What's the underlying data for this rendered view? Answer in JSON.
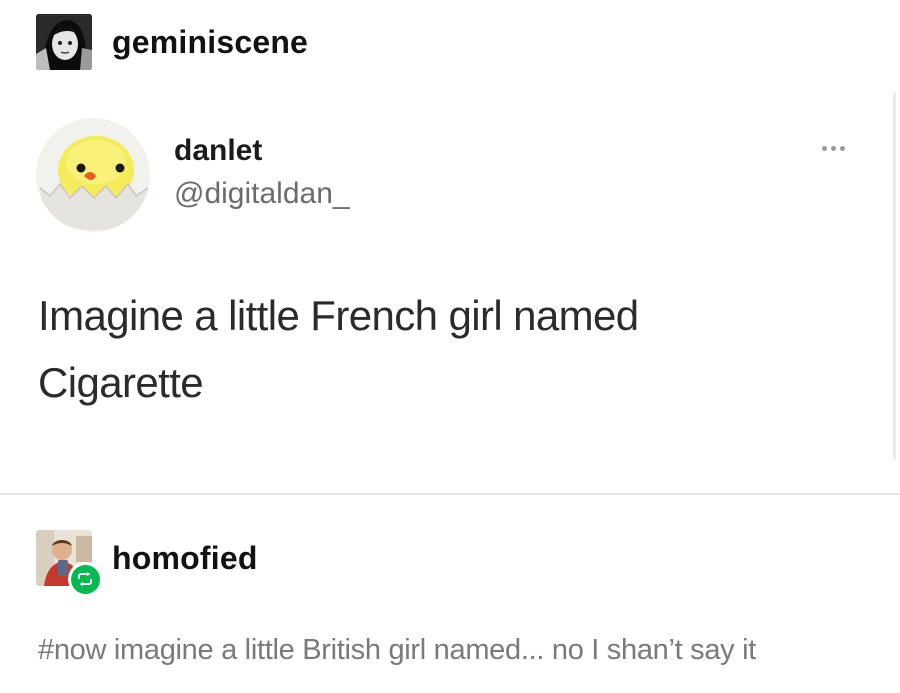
{
  "original_post": {
    "username": "geminiscene",
    "avatar_icon": "bw-portrait-avatar"
  },
  "tweet": {
    "display_name": "danlet",
    "handle": "@digitaldan_",
    "text_line1": "Imagine a little French girl named",
    "text_line2": "Cigarette",
    "avatar_icon": "chick-in-eggshell-avatar",
    "more_icon": "ellipsis-icon"
  },
  "reblog": {
    "username": "homofied",
    "avatar_icon": "selfie-avatar",
    "badge_icon": "reblog-icon",
    "badge_color": "#00b94f",
    "tags": "#now imagine a little British girl named... no I shan’t say it"
  }
}
